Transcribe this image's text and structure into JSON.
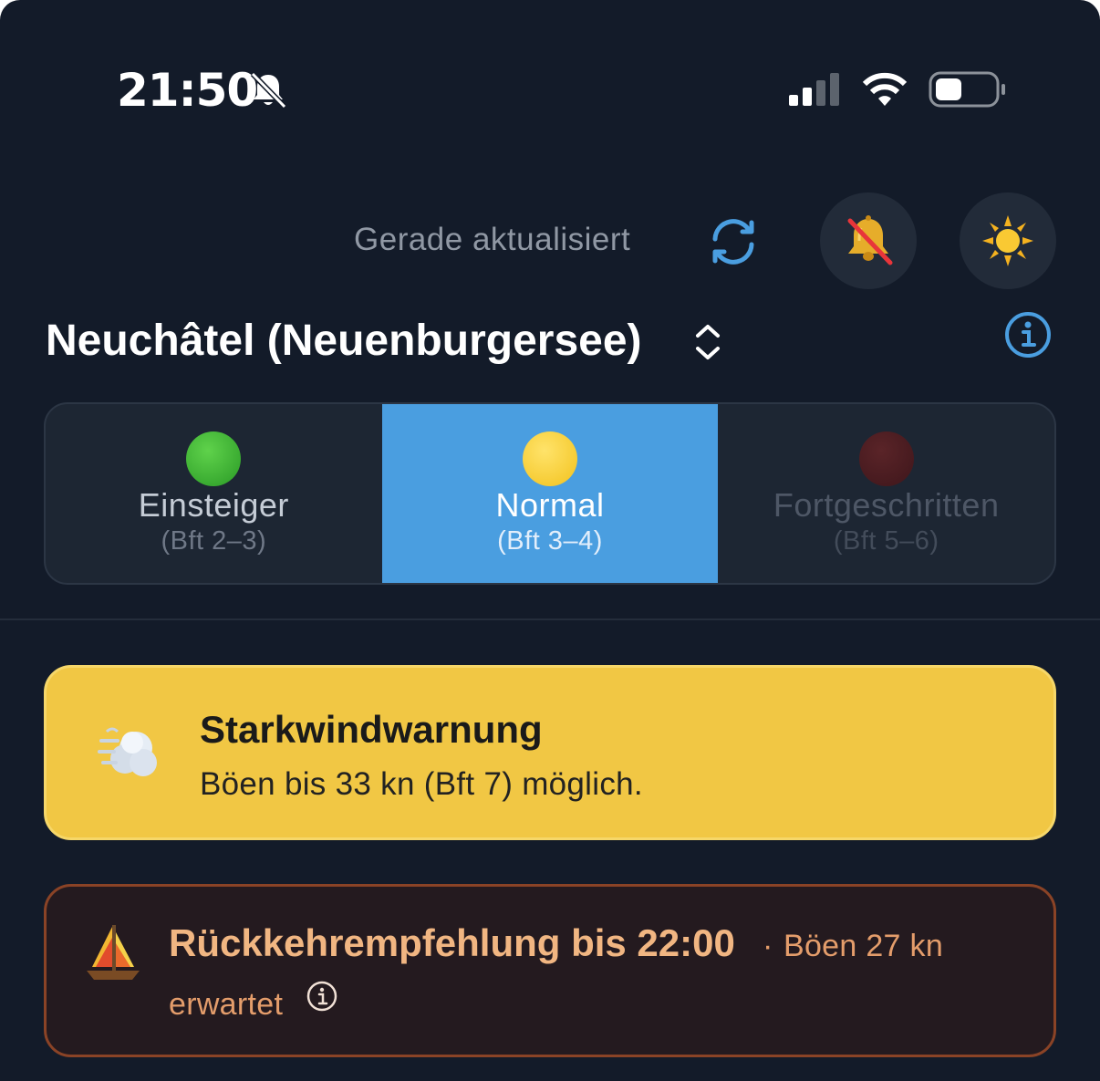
{
  "status_bar": {
    "time": "21:50",
    "icons": [
      "bell-slash-icon",
      "cellular-signal-icon",
      "wifi-icon",
      "battery-icon"
    ]
  },
  "header": {
    "updated_text": "Gerade aktualisiert",
    "refresh_icon": "refresh-icon",
    "notifications_icon": "bell-crossed-icon",
    "theme_icon": "sun-icon"
  },
  "location": {
    "title": "Neuchâtel (Neuenburgersee)",
    "picker_icon": "chevron-up-down-icon",
    "info_icon": "info-circle-icon"
  },
  "levels": {
    "selected": "Normal",
    "items": [
      {
        "label": "Einsteiger",
        "sub": "(Bft 2–3)",
        "dot_color": "#34b233"
      },
      {
        "label": "Normal",
        "sub": "(Bft 3–4)",
        "dot_color": "#f5cf33"
      },
      {
        "label": "Fortgeschritten",
        "sub": "(Bft 5–6)",
        "dot_color": "#4a1d22"
      }
    ]
  },
  "warning": {
    "icon": "wind-face-icon",
    "title": "Starkwindwarnung",
    "text": "Böen bis 33 kn (Bft 7) möglich.",
    "background": "#f1c744"
  },
  "return_advice": {
    "icon": "sailboat-icon",
    "title": "Rückkehrempfehlung bis 22:00",
    "separator": "·",
    "gusts": "Böen 27 kn",
    "expected": "erwartet",
    "info_icon": "info-circle-icon",
    "accent": "#f1b682"
  },
  "colors": {
    "background": "#131b29",
    "accent_blue": "#4a9ee0"
  }
}
